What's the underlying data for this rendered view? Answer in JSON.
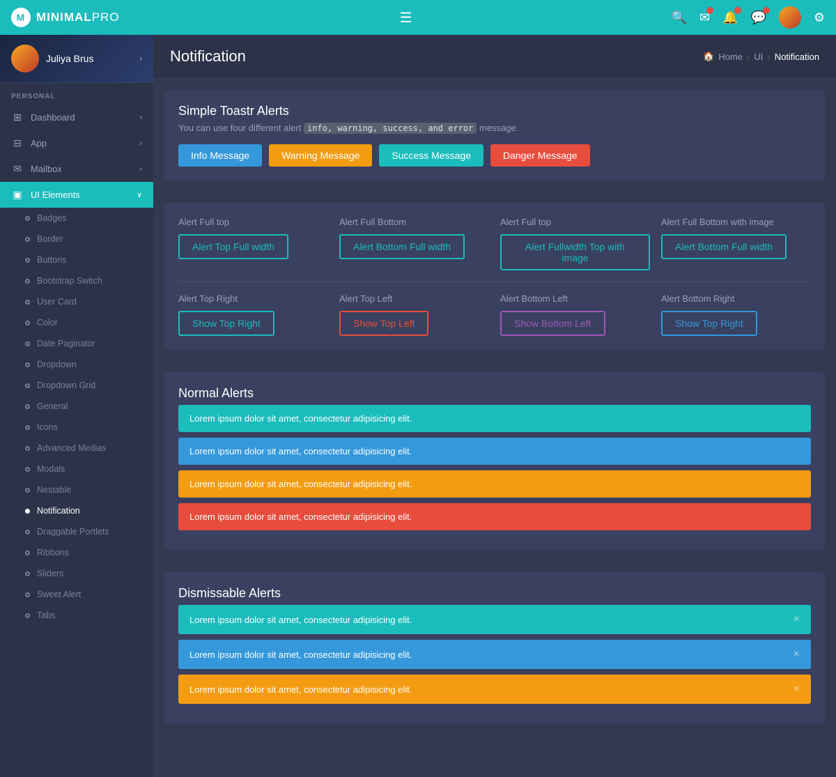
{
  "brand": {
    "name_minimal": "MINIMAL",
    "name_pro": "PRO",
    "logo_letter": "M"
  },
  "topnav": {
    "hamburger_icon": "☰",
    "search_icon": "🔍",
    "email_icon": "✉",
    "bell_icon": "🔔",
    "chat_icon": "💬",
    "gear_icon": "⚙"
  },
  "sidebar": {
    "user_name": "Juliya Brus",
    "section_label": "PERSONAL",
    "menu_items": [
      {
        "id": "dashboard",
        "label": "Dashboard",
        "icon": "⊞",
        "has_arrow": true
      },
      {
        "id": "app",
        "label": "App",
        "icon": "⊟",
        "has_arrow": true
      },
      {
        "id": "mailbox",
        "label": "Mailbox",
        "icon": "✉",
        "has_arrow": true
      },
      {
        "id": "ui-elements",
        "label": "UI Elements",
        "icon": "▣",
        "has_arrow": true,
        "active": true
      }
    ],
    "sub_items": [
      {
        "id": "badges",
        "label": "Badges",
        "active": false
      },
      {
        "id": "border",
        "label": "Border",
        "active": false
      },
      {
        "id": "buttons",
        "label": "Buttons",
        "active": false
      },
      {
        "id": "bootstrap-switch",
        "label": "Bootstrap Switch",
        "active": false
      },
      {
        "id": "user-card",
        "label": "User Card",
        "active": false
      },
      {
        "id": "color",
        "label": "Color",
        "active": false
      },
      {
        "id": "date-paginator",
        "label": "Date Paginator",
        "active": false
      },
      {
        "id": "dropdown",
        "label": "Dropdown",
        "active": false
      },
      {
        "id": "dropdown-grid",
        "label": "Dropdown Grid",
        "active": false
      },
      {
        "id": "general",
        "label": "General",
        "active": false
      },
      {
        "id": "icons",
        "label": "Icons",
        "active": false
      },
      {
        "id": "advanced-medias",
        "label": "Advanced Medias",
        "active": false
      },
      {
        "id": "modals",
        "label": "Modals",
        "active": false
      },
      {
        "id": "nestable",
        "label": "Nestable",
        "active": false
      },
      {
        "id": "notification",
        "label": "Notification",
        "active": true
      },
      {
        "id": "draggable-portlets",
        "label": "Draggable Portlets",
        "active": false
      },
      {
        "id": "ribbons",
        "label": "Ribbons",
        "active": false
      },
      {
        "id": "sliders",
        "label": "Sliders",
        "active": false
      },
      {
        "id": "sweet-alert",
        "label": "Sweet Alert",
        "active": false
      },
      {
        "id": "tabs",
        "label": "Tabs",
        "active": false
      }
    ]
  },
  "page": {
    "title": "Notification",
    "breadcrumb": {
      "home": "Home",
      "section": "UI",
      "current": "Notification"
    }
  },
  "simple_toastr": {
    "title": "Simple Toastr Alerts",
    "description_prefix": "You can use four different alert ",
    "description_code": "info, warning, success, and error",
    "description_suffix": " message.",
    "buttons": [
      {
        "id": "info-msg",
        "label": "Info Message",
        "style": "btn-info"
      },
      {
        "id": "warning-msg",
        "label": "Warning Message",
        "style": "btn-warning"
      },
      {
        "id": "success-msg",
        "label": "Success Message",
        "style": "btn-success"
      },
      {
        "id": "danger-msg",
        "label": "Danger Message",
        "style": "btn-danger"
      }
    ]
  },
  "alert_positions": {
    "columns": [
      {
        "title": "Alert Full top",
        "button_label": "Alert Top Full width",
        "button_style": "btn-outline-teal"
      },
      {
        "title": "Alert Full Bottom",
        "button_label": "Alert Bottom Full width",
        "button_style": "btn-outline-teal"
      },
      {
        "title": "Alert Full top",
        "button_label": "Alert Fullwidth Top with image",
        "button_style": "btn-outline-teal"
      },
      {
        "title": "Alert Full Bottom with image",
        "button_label": "Alert Bottom Full width",
        "button_style": "btn-outline-teal"
      }
    ],
    "columns2": [
      {
        "title": "Alert Top Right",
        "button_label": "Show Top Right",
        "button_style": "btn-outline-teal"
      },
      {
        "title": "Alert Top Left",
        "button_label": "Show Top Left",
        "button_style": "btn-outline-pink"
      },
      {
        "title": "Alert Bottom Left",
        "button_label": "Show Bottom Left",
        "button_style": "btn-outline-purple"
      },
      {
        "title": "Alert Bottom Right",
        "button_label": "Show Top Right",
        "button_style": "btn-outline-blue"
      }
    ]
  },
  "normal_alerts": {
    "title": "Normal Alerts",
    "items": [
      {
        "text": "Lorem ipsum dolor sit amet, consectetur adipisicing elit.",
        "style": "alert-teal"
      },
      {
        "text": "Lorem ipsum dolor sit amet, consectetur adipisicing elit.",
        "style": "alert-blue"
      },
      {
        "text": "Lorem ipsum dolor sit amet, consectetur adipisicing elit.",
        "style": "alert-yellow"
      },
      {
        "text": "Lorem ipsum dolor sit amet, consectetur adipisicing elit.",
        "style": "alert-red"
      }
    ]
  },
  "dismissable_alerts": {
    "title": "Dismissable Alerts",
    "items": [
      {
        "text": "Lorem ipsum dolor sit amet, consectetur adipisicing elit.",
        "style": "alert-teal"
      },
      {
        "text": "Lorem ipsum dolor sit amet, consectetur adipisicing elit.",
        "style": "alert-blue"
      },
      {
        "text": "Lorem ipsum dolor sit amet, consectetur adipisicing elit.",
        "style": "alert-yellow"
      }
    ],
    "dismiss_symbol": "×"
  }
}
